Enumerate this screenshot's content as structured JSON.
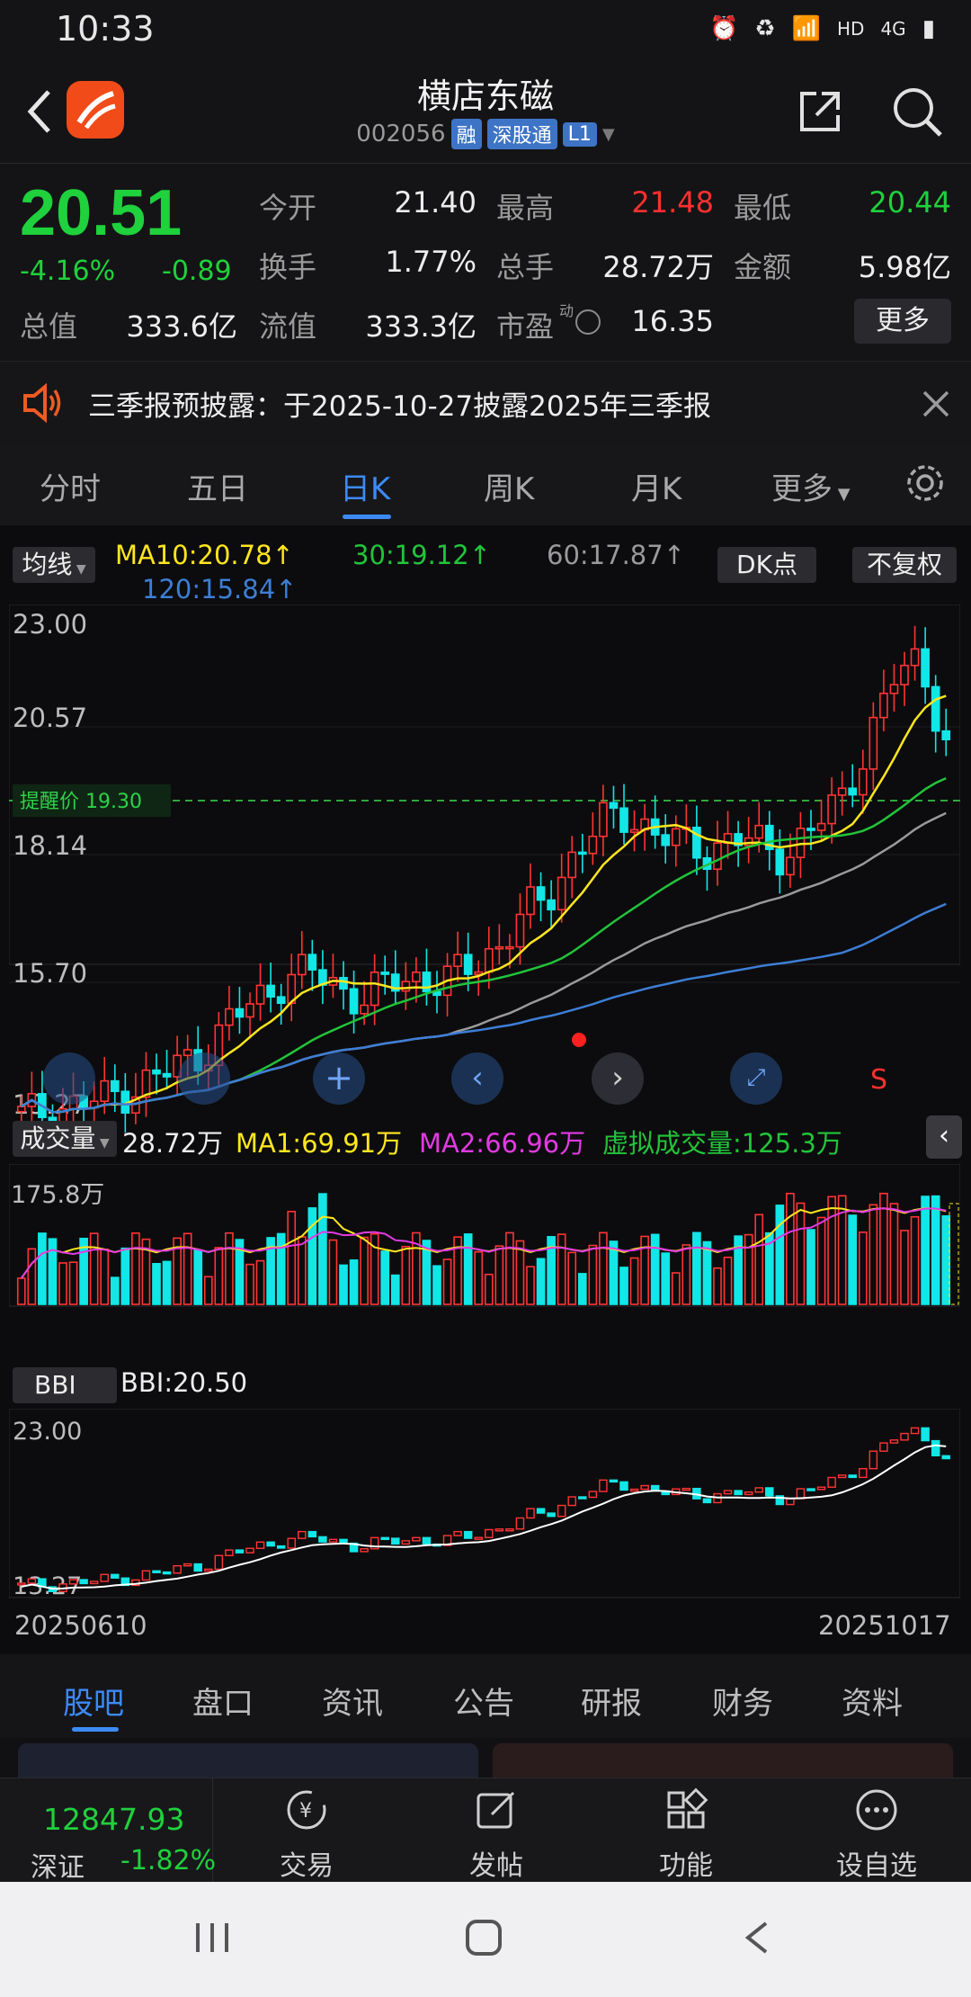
{
  "status": {
    "time": "10:33",
    "hd": "HD",
    "net": "4G"
  },
  "header": {
    "title": "横店东磁",
    "code": "002056",
    "tags": [
      "融",
      "深股通",
      "L1"
    ]
  },
  "quote": {
    "price": "20.51",
    "pct": "-4.16%",
    "chg": "-0.89",
    "labels": {
      "open": "今开",
      "high": "最高",
      "low": "最低",
      "turnover": "换手",
      "volume": "总手",
      "amount": "金额",
      "mcap": "总值",
      "float": "流值",
      "pe": "市盈"
    },
    "values": {
      "open": "21.40",
      "high": "21.48",
      "low": "20.44",
      "turnover": "1.77%",
      "volume": "28.72万",
      "amount": "5.98亿",
      "mcap": "333.6亿",
      "float": "333.3亿",
      "pe": "16.35"
    },
    "pe_super": "动",
    "more": "更多",
    "colors": {
      "down": "#1fd13c",
      "up": "#ff3030"
    }
  },
  "notice": {
    "text": "三季报预披露：于2025-10-27披露2025年三季报"
  },
  "ktabs": [
    "分时",
    "五日",
    "日K",
    "周K",
    "月K",
    "更多"
  ],
  "ktab_active": 2,
  "chart": {
    "ma_btn": "均线",
    "ma10": "MA10:20.78↑",
    "ma30": "30:19.12↑",
    "ma60": "60:17.87↑",
    "ma120": "120:15.84↑",
    "dk_btn": "DK点",
    "fq_btn": "不复权",
    "y_labels": [
      "23.00",
      "20.57",
      "18.14",
      "15.70",
      "13.27"
    ],
    "alert_label": "提醒价 19.30",
    "signal": "S",
    "vol_btn": "成交量",
    "vol_val": "28.72万",
    "vol_ma1": "MA1:69.91万",
    "vol_ma2": "MA2:66.96万",
    "vol_virtual": "虚拟成交量:125.3万",
    "vol_max": "175.8万",
    "bbi_btn": "BBI",
    "bbi_val": "BBI:20.50",
    "bbi_y": [
      "23.00",
      "13.27"
    ],
    "date_start": "20250610",
    "date_end": "20251017"
  },
  "chart_data": {
    "type": "candlestick",
    "ylim": [
      13.27,
      23.0
    ],
    "x": [
      "20250610",
      "20251017"
    ],
    "close_trend": [
      13.3,
      13.4,
      13.5,
      13.6,
      13.8,
      14.0,
      14.3,
      14.6,
      15.2,
      15.6,
      16.0,
      16.1,
      15.8,
      15.6,
      15.9,
      16.0,
      15.9,
      16.2,
      16.6,
      17.2,
      17.6,
      18.5,
      19.0,
      19.2,
      18.8,
      18.6,
      18.5,
      18.7,
      18.6,
      18.4,
      18.9,
      19.5,
      20.5,
      21.8,
      22.3,
      20.51
    ],
    "ma_lines": {
      "MA10": 20.78,
      "MA30": 19.12,
      "MA60": 17.87,
      "MA120": 15.84
    },
    "alert_price": 19.3,
    "volume_max": "175.8万",
    "bbi": 20.5
  },
  "subtabs": [
    "股吧",
    "盘口",
    "资讯",
    "公告",
    "研报",
    "财务",
    "资料"
  ],
  "index": {
    "value": "12847.93",
    "name": "深证",
    "pct": "-1.82%"
  },
  "bottomnav": [
    "交易",
    "发帖",
    "功能",
    "设自选"
  ]
}
